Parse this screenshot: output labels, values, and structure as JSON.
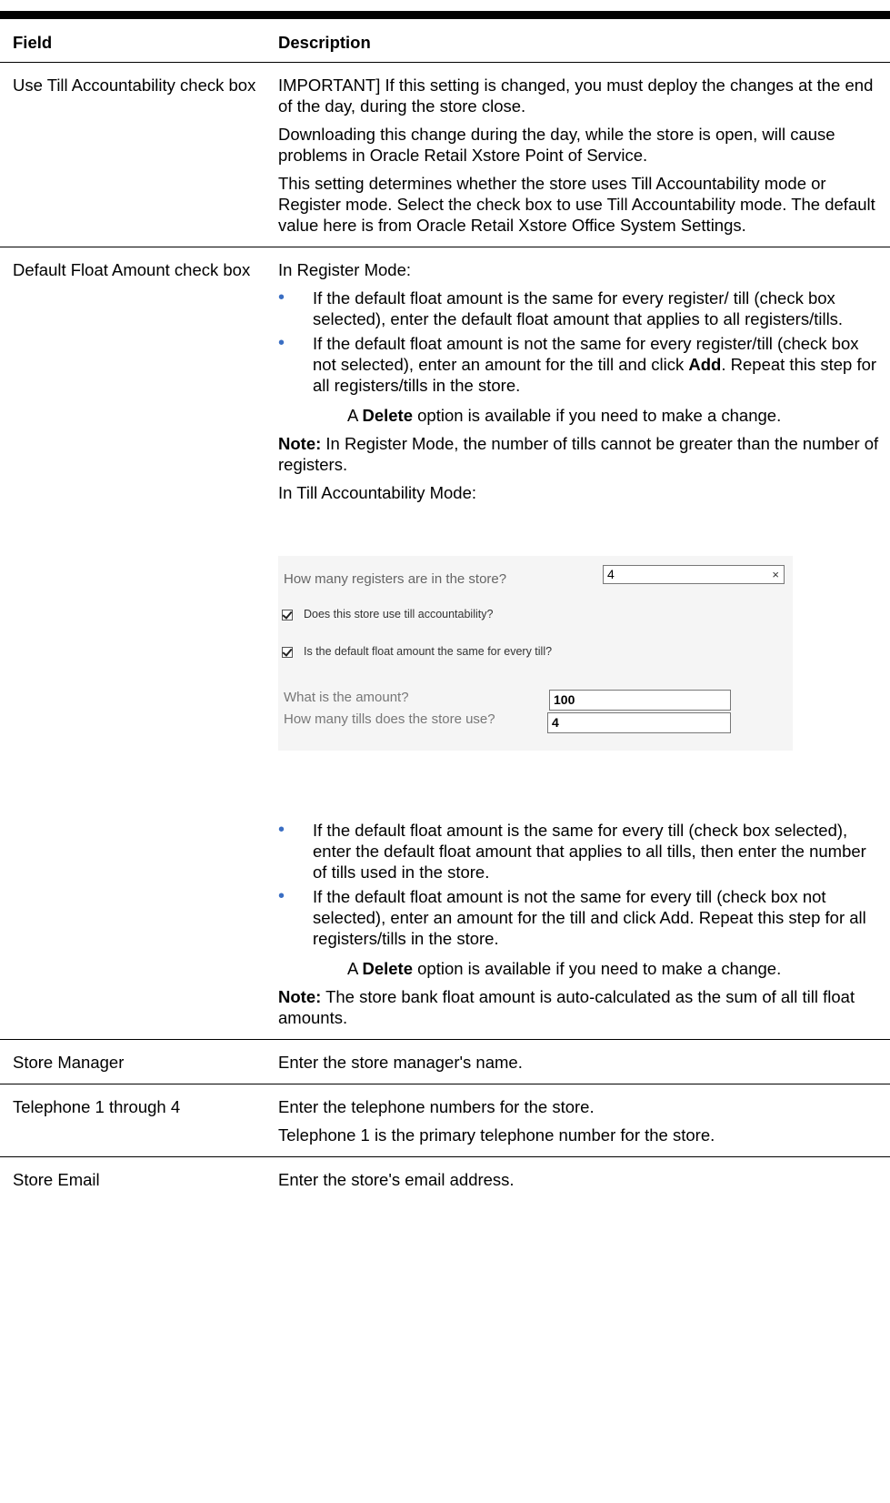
{
  "table": {
    "header": {
      "field": "Field",
      "description": "Description"
    },
    "rows": {
      "till": {
        "field": "Use Till Accountability check box",
        "p1": "IMPORTANT] If this setting is changed, you must deploy the changes at the end of the day, during the store close.",
        "p2": "Downloading this change during the day, while the store is open, will cause problems in Oracle Retail Xstore Point of Service.",
        "p3": "This setting determines whether the store uses Till Accountability mode or Register mode. Select the check box to use Till Accountability mode. The default value here is from Oracle Retail Xstore Office System Settings."
      },
      "float": {
        "field": "Default Float Amount check box",
        "register_heading": "In Register Mode:",
        "reg_b1": "If the default float amount is the same for every register/ till (check box selected), enter the default float amount that applies to all registers/tills.",
        "reg_b2_a": "If the default float amount is not the same for every register/till (check box not selected), enter an amount for the till and click ",
        "reg_b2_bold": "Add",
        "reg_b2_b": ". Repeat this step for all registers/tills in the store.",
        "reg_del_a": "A ",
        "reg_del_bold": "Delete",
        "reg_del_b": " option is available if you need to make a change.",
        "reg_note_bold": "Note:",
        "reg_note": " In Register Mode, the number of tills cannot be greater than the number of registers.",
        "till_heading": "In Till Accountability Mode:",
        "till_b1": "If the default float amount is the same for every till (check box selected), enter the default float amount that applies to all tills, then enter the number of tills used in the store.",
        "till_b2": "If the default float amount is not the same for every till (check box not selected), enter an amount for the till and click Add. Repeat this step for all registers/tills in the store.",
        "till_del_a": "A ",
        "till_del_bold": "Delete",
        "till_del_b": " option is available if you need to make a change.",
        "till_note_bold": "Note:",
        "till_note": " The store bank float amount is auto-calculated as the sum of all till float amounts."
      },
      "manager": {
        "field": "Store Manager",
        "desc": "Enter the store manager's name."
      },
      "telephone": {
        "field": "Telephone 1 through 4",
        "p1": "Enter the telephone numbers for the store.",
        "p2": "Telephone 1 is the primary telephone number for the store."
      },
      "email": {
        "field": "Store Email",
        "desc": "Enter the store's email address."
      }
    }
  },
  "figure": {
    "registers_question": "How many registers are in the store?",
    "registers_value": "4",
    "clear_icon": "×",
    "till_accountability_label": "Does this store use till accountability?",
    "till_accountability_checked": true,
    "same_float_label": "Is the default float amount the same for every till?",
    "same_float_checked": true,
    "amount_question": "What is the amount?",
    "amount_value": "100",
    "tills_question": "How many tills does the store use?",
    "tills_value": "4"
  },
  "bullet_color": "#3a6ec3"
}
